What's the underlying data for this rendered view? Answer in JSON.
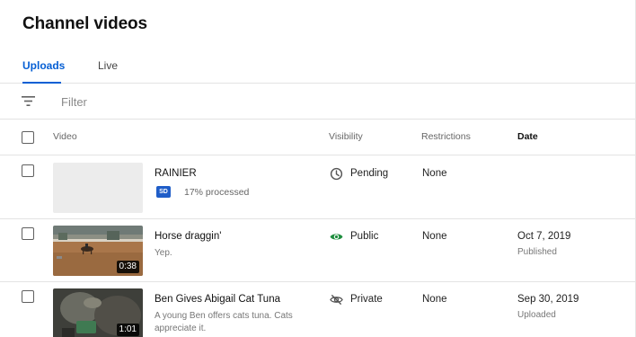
{
  "page": {
    "title": "Channel videos"
  },
  "tabs": [
    {
      "label": "Uploads",
      "active": true
    },
    {
      "label": "Live",
      "active": false
    }
  ],
  "filter": {
    "placeholder": "Filter",
    "icon": "filter-icon"
  },
  "columns": {
    "video": "Video",
    "visibility": "Visibility",
    "restrictions": "Restrictions",
    "date": "Date"
  },
  "colors": {
    "accent": "#065fd4",
    "public_green": "#1e8e3e",
    "sd_badge": "#1f5dc8"
  },
  "rows": [
    {
      "title": "RAINIER",
      "badge": "SD",
      "status": "17% processed",
      "description": "",
      "duration": "",
      "visibility": "Pending",
      "visibility_icon": "clock-icon",
      "restrictions": "None",
      "date": "",
      "date_status": ""
    },
    {
      "title": "Horse draggin'",
      "description": "Yep.",
      "duration": "0:38",
      "visibility": "Public",
      "visibility_icon": "eye-icon",
      "restrictions": "None",
      "date": "Oct 7, 2019",
      "date_status": "Published"
    },
    {
      "title": "Ben Gives Abigail Cat Tuna",
      "description": "A young Ben offers cats tuna. Cats appreciate it.",
      "duration": "1:01",
      "visibility": "Private",
      "visibility_icon": "eye-off-icon",
      "restrictions": "None",
      "date": "Sep 30, 2019",
      "date_status": "Uploaded"
    }
  ]
}
